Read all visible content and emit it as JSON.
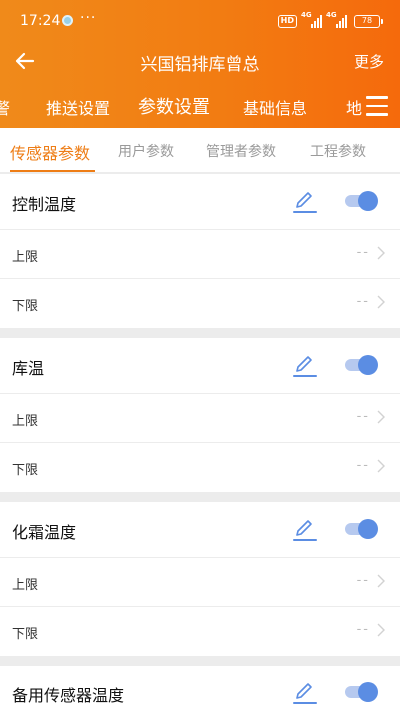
{
  "status": {
    "time": "17:24",
    "dots": "···",
    "hd": "HD",
    "net1": "4G",
    "net2": "4G",
    "battery": "78"
  },
  "nav": {
    "title": "兴国铝排库曾总",
    "more": "更多"
  },
  "top_tabs": [
    "警",
    "推送设置",
    "参数设置",
    "基础信息",
    "地"
  ],
  "sub_tabs": [
    "传感器参数",
    "用户参数",
    "管理者参数",
    "工程参数"
  ],
  "colors": {
    "accent": "#ee7d16",
    "toggle_on": "#5b8de3"
  },
  "sections": [
    {
      "name": "控制温度",
      "enabled": true,
      "upper_label": "上限",
      "upper_value": "--",
      "lower_label": "下限",
      "lower_value": "--"
    },
    {
      "name": "库温",
      "enabled": true,
      "upper_label": "上限",
      "upper_value": "--",
      "lower_label": "下限",
      "lower_value": "--"
    },
    {
      "name": "化霜温度",
      "enabled": true,
      "upper_label": "上限",
      "upper_value": "--",
      "lower_label": "下限",
      "lower_value": "--"
    },
    {
      "name": "备用传感器温度",
      "enabled": true
    }
  ]
}
